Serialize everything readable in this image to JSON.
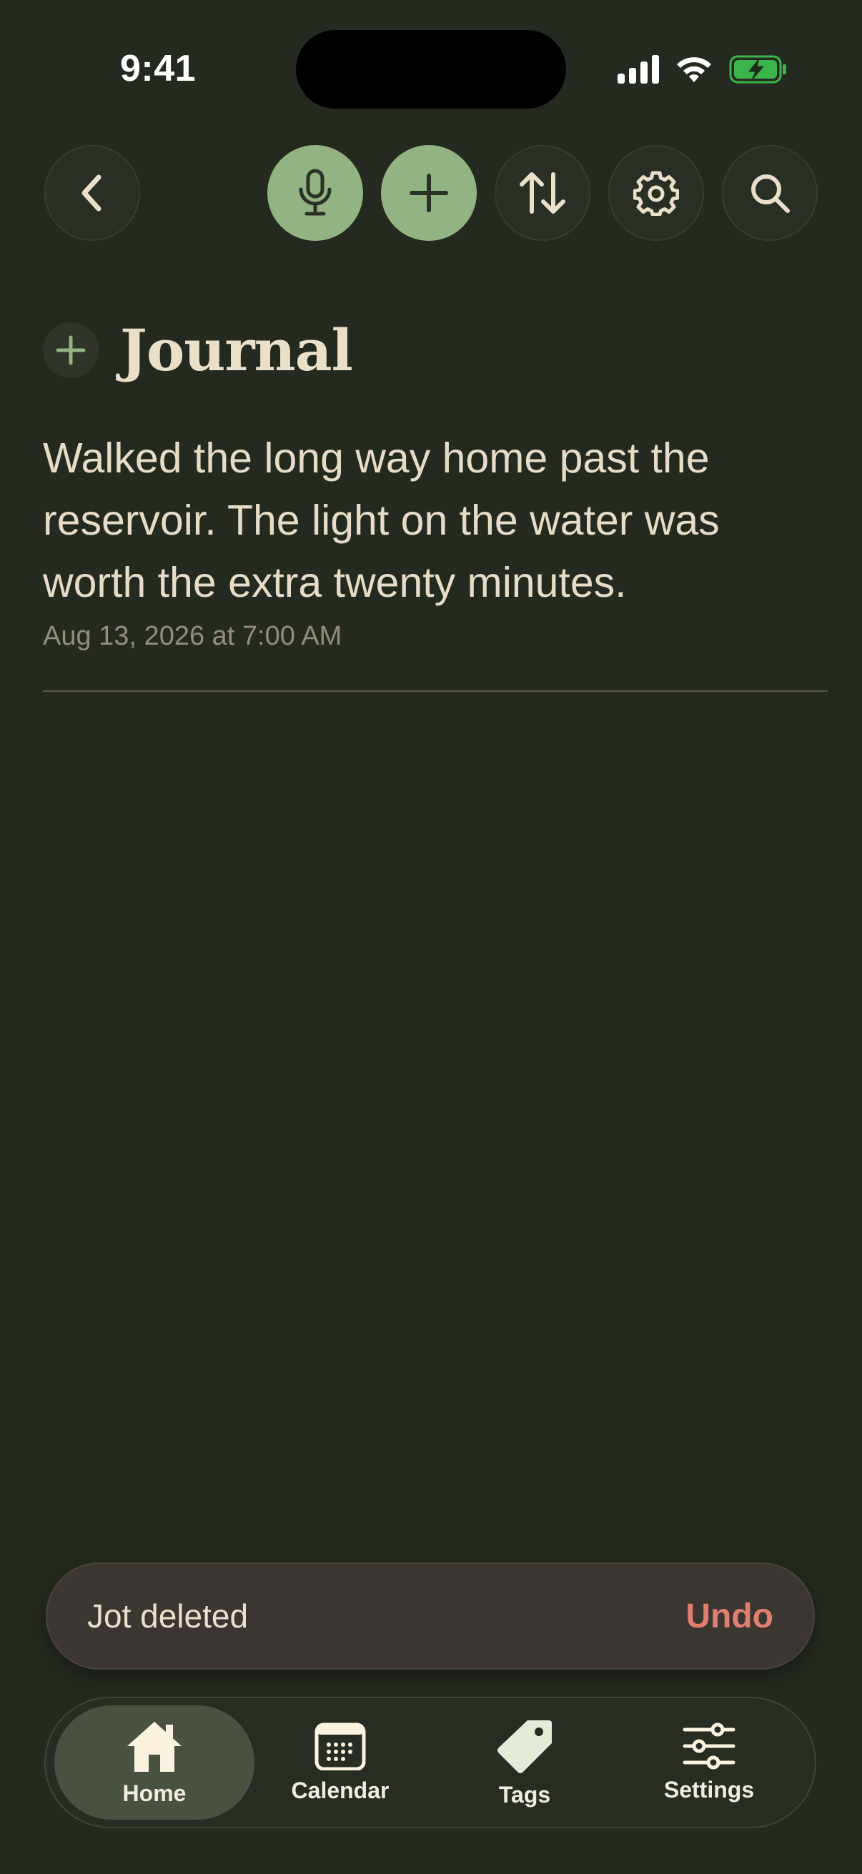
{
  "status": {
    "time": "9:41"
  },
  "toolbar": {
    "back_icon": "chevron-left-icon",
    "mic_icon": "microphone-icon",
    "add_icon": "plus-icon",
    "sort_icon": "sort-arrows-icon",
    "settings_icon": "gear-icon",
    "search_icon": "search-icon"
  },
  "header": {
    "title": "Journal"
  },
  "entries": [
    {
      "text": "Walked the long way home past the reservoir. The light on the water was worth the extra twenty minutes.",
      "date": "Aug 13, 2026 at 7:00 AM"
    }
  ],
  "toast": {
    "message": "Jot deleted",
    "action": "Undo"
  },
  "tabbar": {
    "items": [
      {
        "label": "Home",
        "icon": "house-icon",
        "active": true
      },
      {
        "label": "Calendar",
        "icon": "calendar-icon",
        "active": false
      },
      {
        "label": "Tags",
        "icon": "tag-icon",
        "active": false
      },
      {
        "label": "Settings",
        "icon": "sliders-icon",
        "active": false
      }
    ]
  },
  "colors": {
    "background": "#252a20",
    "accent_green": "#93b382",
    "undo_red": "#e07f70",
    "text": "#e9dfcb"
  }
}
